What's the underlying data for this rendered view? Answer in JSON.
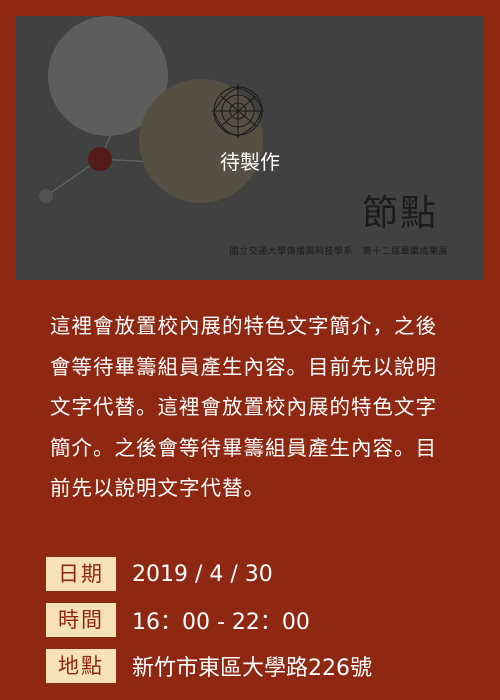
{
  "banner": {
    "caption": "待製作",
    "title": "節點",
    "subtitle": "國立交通大學傳播與科技學系　第十二屆畢業成果展"
  },
  "description": "這裡會放置校內展的特色文字簡介，之後會等待畢籌組員產生內容。目前先以說明文字代替。這裡會放置校內展的特色文字簡介。之後會等待畢籌組員產生內容。目前先以說明文字代替。",
  "info": {
    "date": {
      "label": "日期",
      "value": "2019 / 4 / 30"
    },
    "time": {
      "label": "時間",
      "value": "16：00 - 22：00"
    },
    "location": {
      "label": "地點",
      "value": "新竹市東區大學路226號"
    }
  },
  "colors": {
    "background": "#8e2812",
    "label_bg": "#f7e1b8",
    "label_text": "#8e2812",
    "banner_bg": "#4f4f4f"
  }
}
